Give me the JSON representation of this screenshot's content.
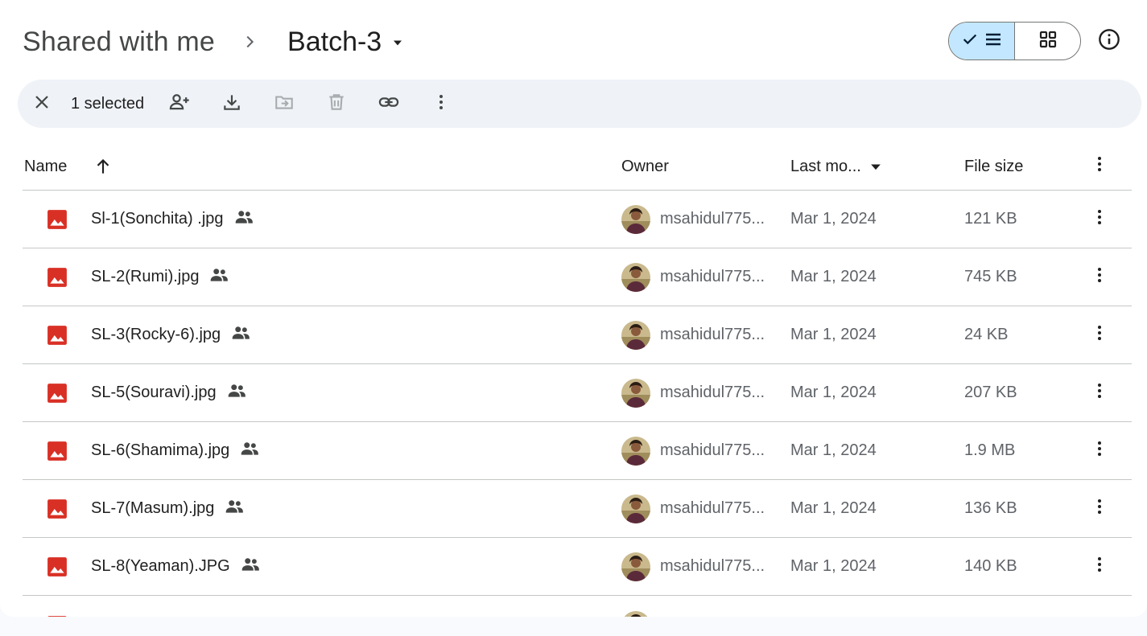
{
  "breadcrumb": {
    "root": "Shared with me",
    "current": "Batch-3"
  },
  "view": {
    "list_icon": "list-view-icon",
    "grid_icon": "grid-view-icon",
    "active": "list"
  },
  "selection_bar": {
    "count_label": "1 selected",
    "actions": [
      "share",
      "download",
      "move",
      "trash",
      "copy-link",
      "more-actions"
    ]
  },
  "columns": {
    "name": "Name",
    "owner": "Owner",
    "modified": "Last mo...",
    "size": "File size"
  },
  "files": [
    {
      "name": "Sl-1(Sonchita) .jpg",
      "owner": "msahidul775...",
      "modified": "Mar 1, 2024",
      "size": "121 KB"
    },
    {
      "name": "SL-2(Rumi).jpg",
      "owner": "msahidul775...",
      "modified": "Mar 1, 2024",
      "size": "745 KB"
    },
    {
      "name": "SL-3(Rocky-6).jpg",
      "owner": "msahidul775...",
      "modified": "Mar 1, 2024",
      "size": "24 KB"
    },
    {
      "name": "SL-5(Souravi).jpg",
      "owner": "msahidul775...",
      "modified": "Mar 1, 2024",
      "size": "207 KB"
    },
    {
      "name": "SL-6(Shamima).jpg",
      "owner": "msahidul775...",
      "modified": "Mar 1, 2024",
      "size": "1.9 MB"
    },
    {
      "name": "SL-7(Masum).jpg",
      "owner": "msahidul775...",
      "modified": "Mar 1, 2024",
      "size": "136 KB"
    },
    {
      "name": "SL-8(Yeaman).JPG",
      "owner": "msahidul775...",
      "modified": "Mar 1, 2024",
      "size": "140 KB"
    }
  ],
  "colors": {
    "accent": "#c2e7ff",
    "image_icon": "#d93025",
    "toolbar_bg": "#eff2f7",
    "divider": "#c4c7c5"
  }
}
